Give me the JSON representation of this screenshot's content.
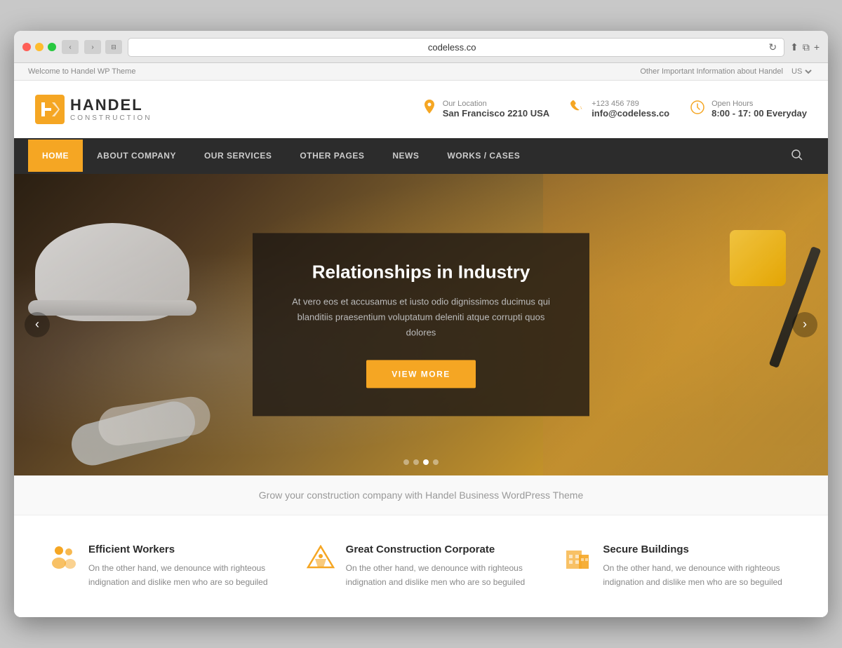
{
  "browser": {
    "url": "codeless.co",
    "dots": [
      "red",
      "yellow",
      "green"
    ]
  },
  "topbar": {
    "left": "Welcome to Handel WP Theme",
    "right": "Other Important Information about Handel",
    "lang": "US"
  },
  "header": {
    "logo_letter": "H",
    "logo_name": "HANDEL",
    "logo_sub": "CONSTRUCTION",
    "info_items": [
      {
        "icon": "📍",
        "label": "Our Location",
        "value": "San Francisco 2210 USA"
      },
      {
        "icon": "📞",
        "label": "+123 456 789",
        "value": "info@codeless.co"
      },
      {
        "icon": "🕐",
        "label": "Open Hours",
        "value": "8:00 - 17: 00 Everyday"
      }
    ]
  },
  "nav": {
    "items": [
      {
        "label": "HOME",
        "active": true
      },
      {
        "label": "ABOUT COMPANY",
        "active": false
      },
      {
        "label": "OUR SERVICES",
        "active": false
      },
      {
        "label": "OTHER PAGES",
        "active": false
      },
      {
        "label": "NEWS",
        "active": false
      },
      {
        "label": "WORKS / CASES",
        "active": false
      }
    ]
  },
  "hero": {
    "title": "Relationships in Industry",
    "text": "At vero eos et accusamus et iusto odio dignissimos ducimus qui blanditiis praesentium voluptatum deleniti atque corrupti quos dolores",
    "button_label": "VIEW MORE",
    "dots": [
      false,
      false,
      true,
      false
    ]
  },
  "tagline": "Grow your construction company with Handel Business WordPress Theme",
  "features": [
    {
      "icon": "👷",
      "title": "Efficient Workers",
      "text": "On the other hand, we denounce with righteous indignation and dislike men who are so beguiled"
    },
    {
      "icon": "🏗️",
      "title": "Great Construction Corporate",
      "text": "On the other hand, we denounce with righteous indignation and dislike men who are so beguiled"
    },
    {
      "icon": "🏢",
      "title": "Secure Buildings",
      "text": "On the other hand, we denounce with righteous indignation and dislike men who are so beguiled"
    }
  ]
}
